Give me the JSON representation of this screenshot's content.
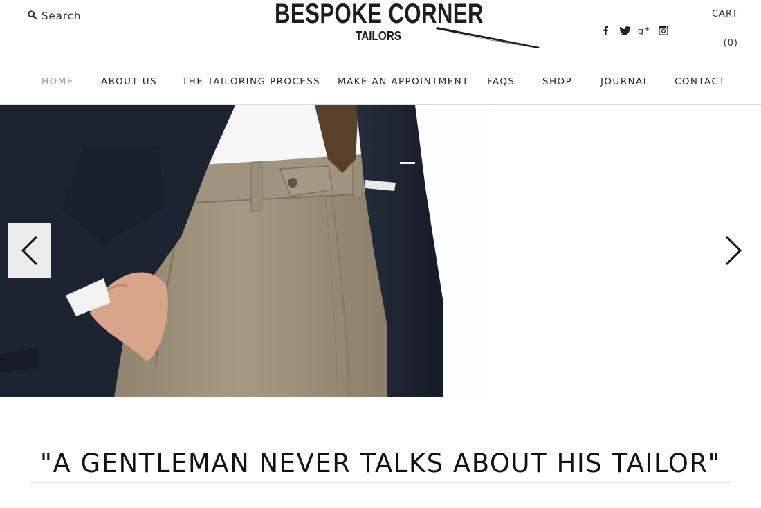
{
  "header": {
    "search_label": "Search",
    "logo_main": "BESPOKE CORNER",
    "logo_sub": "TAILORS",
    "social": [
      "facebook-icon",
      "twitter-icon",
      "google-plus-icon",
      "instagram-icon"
    ],
    "cart_label": "CART",
    "cart_count": "(0)"
  },
  "nav": {
    "items": [
      {
        "label": "HOME",
        "active": true
      },
      {
        "label": "ABOUT US"
      },
      {
        "label": "THE TAILORING PROCESS"
      },
      {
        "label": "MAKE AN APPOINTMENT"
      },
      {
        "label": "FAQS"
      },
      {
        "label": "SHOP"
      },
      {
        "label": "JOURNAL"
      },
      {
        "label": "CONTACT"
      }
    ]
  },
  "slider": {
    "prev_icon": "chevron-left-icon",
    "next_icon": "chevron-right-icon"
  },
  "quote": "\"A GENTLEMAN NEVER TALKS ABOUT HIS TAILOR\"",
  "colors": {
    "nav_active": "#9a9a9a",
    "text": "#222222",
    "jacket": "#1c2431",
    "trousers": "#9c8f7a",
    "tie": "#5a3f2b"
  }
}
